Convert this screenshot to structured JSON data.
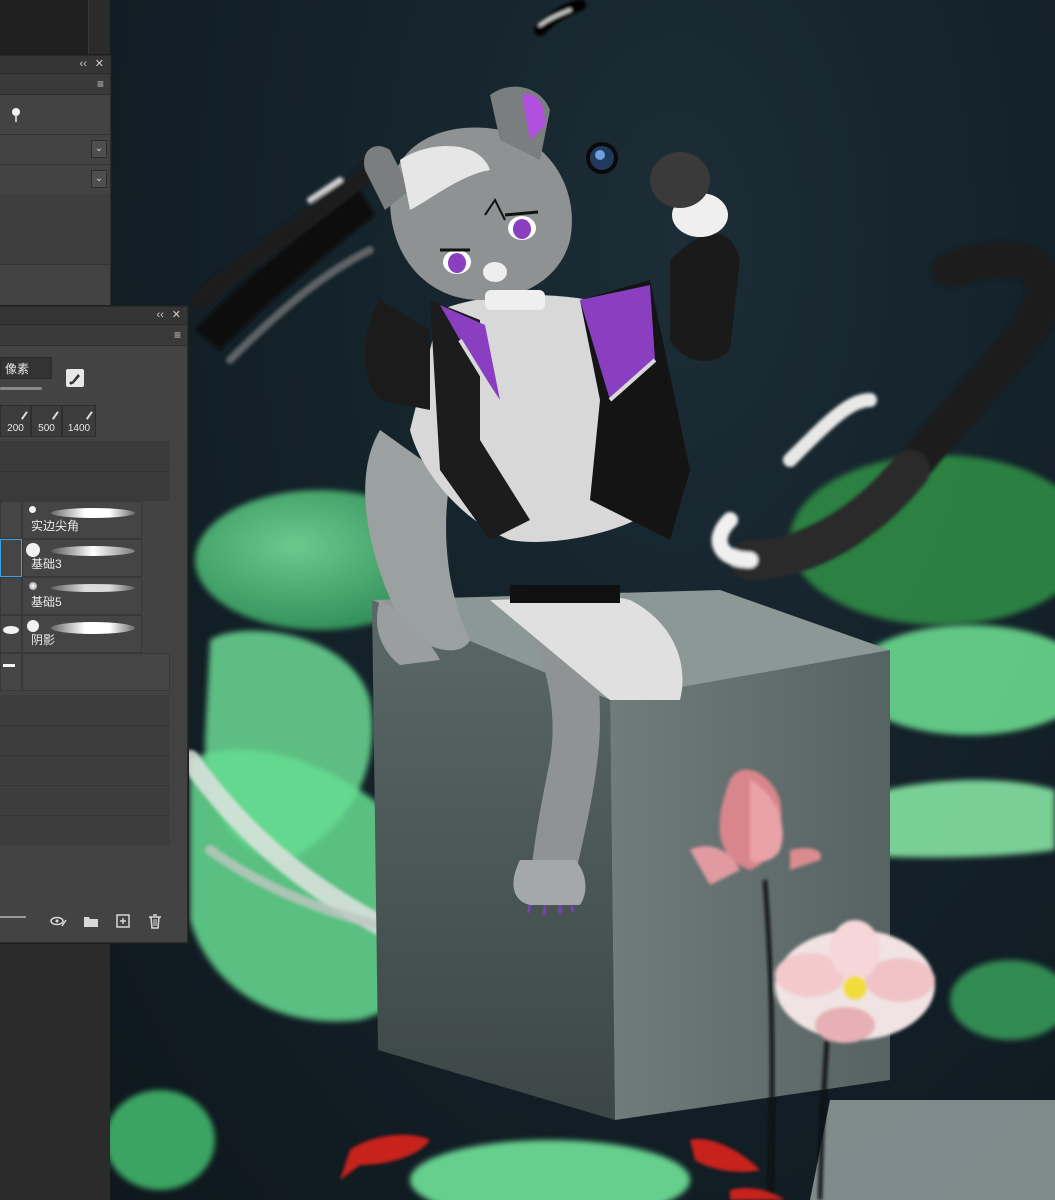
{
  "panels": {
    "top_panel": {
      "controls": {
        "collapse": "‹‹",
        "close": "✕",
        "menu": "≡"
      }
    },
    "brush_panel": {
      "controls": {
        "collapse": "‹‹",
        "close": "✕",
        "menu": "≡"
      },
      "size": {
        "value_text": "像素"
      },
      "presets": [
        {
          "label": "200"
        },
        {
          "label": "500"
        },
        {
          "label": "1400"
        }
      ],
      "brushes": [
        {
          "label": "实边尖角"
        },
        {
          "label": "基础3"
        },
        {
          "label": "基础5"
        },
        {
          "label": "阴影"
        }
      ],
      "toolbar": {
        "icons": [
          "eye-brush-icon",
          "folder-icon",
          "new-brush-icon",
          "trash-icon"
        ]
      }
    }
  },
  "colors": {
    "panel_bg": "#434343",
    "selection": "#3aa0e8",
    "lily_green": "#5fd58a",
    "lotus_pink": "#e9a3a8",
    "accent_purple": "#8a3fc0",
    "koi_red": "#c8221f"
  }
}
